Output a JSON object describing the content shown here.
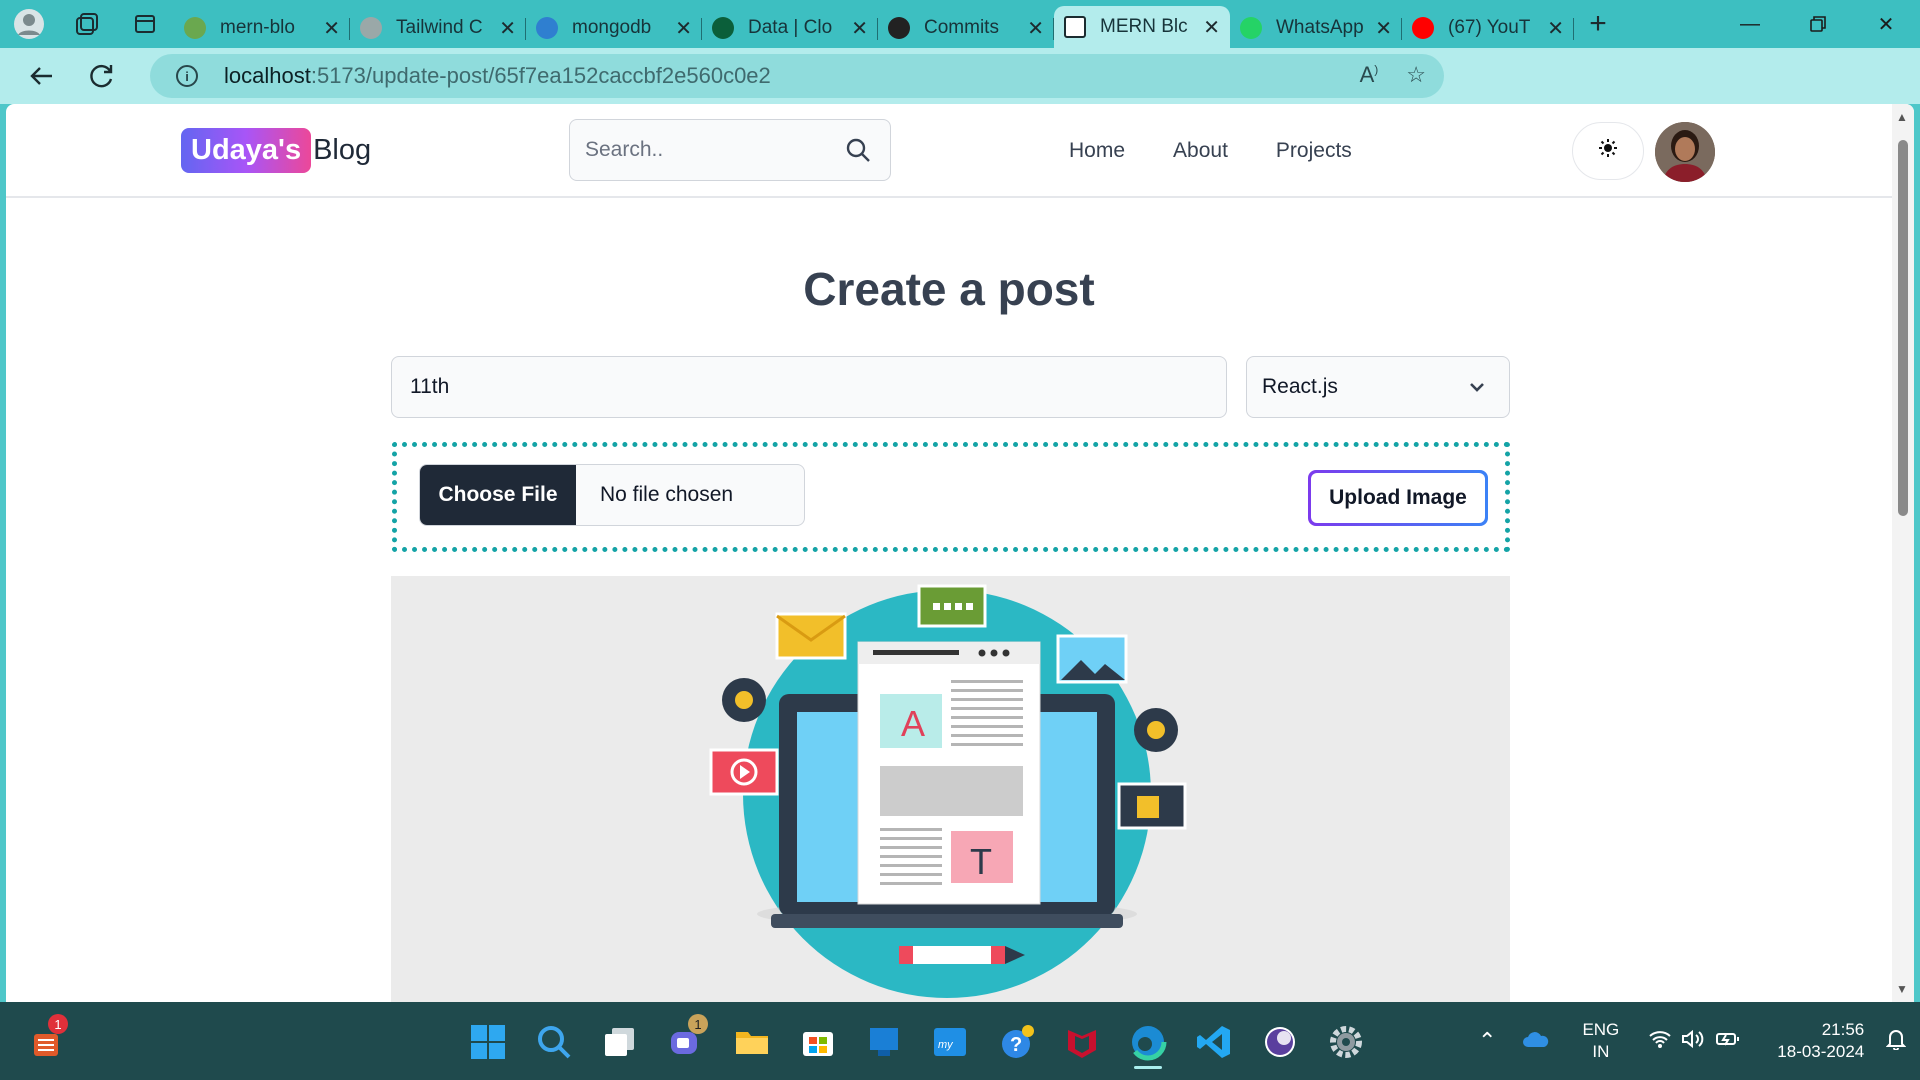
{
  "browser": {
    "tabs": [
      {
        "title": "mern-blo",
        "favicon_color": "#6aa84f"
      },
      {
        "title": "Tailwind C",
        "favicon_color": "#9aa8a8"
      },
      {
        "title": "mongodb",
        "favicon_color": "#2f7fd0"
      },
      {
        "title": "Data | Clo",
        "favicon_color": "#0b5f3a"
      },
      {
        "title": "Commits",
        "favicon_color": "#222222"
      },
      {
        "title": "MERN Blc",
        "favicon_color": "#ffffff"
      },
      {
        "title": "WhatsApp",
        "favicon_color": "#25d366"
      },
      {
        "title": "(67) YouT",
        "favicon_color": "#ff0000"
      }
    ],
    "active_tab_index": 5,
    "url_host": "localhost",
    "url_path": ":5173/update-post/65f7ea152caccbf2e560c0e2"
  },
  "site": {
    "logo_badge": "Udaya's",
    "logo_word": "Blog",
    "search_placeholder": "Search..",
    "nav": [
      "Home",
      "About",
      "Projects"
    ]
  },
  "form": {
    "heading": "Create a post",
    "title_value": "11th",
    "category_selected": "React.js",
    "choose_file_label": "Choose File",
    "no_file_text": "No file chosen",
    "upload_label": "Upload Image"
  },
  "preview_image": {
    "letter_a": "A",
    "letter_t": "T"
  },
  "taskbar": {
    "left_badge": "1",
    "chat_badge": "1",
    "lang_top": "ENG",
    "lang_bottom": "IN",
    "time": "21:56",
    "date": "18-03-2024"
  },
  "colors": {
    "browser_frame": "#3dbfc1",
    "accent_dotted": "#14a3a6",
    "logo_gradient_start": "#6366f1",
    "logo_gradient_end": "#ec4899"
  }
}
